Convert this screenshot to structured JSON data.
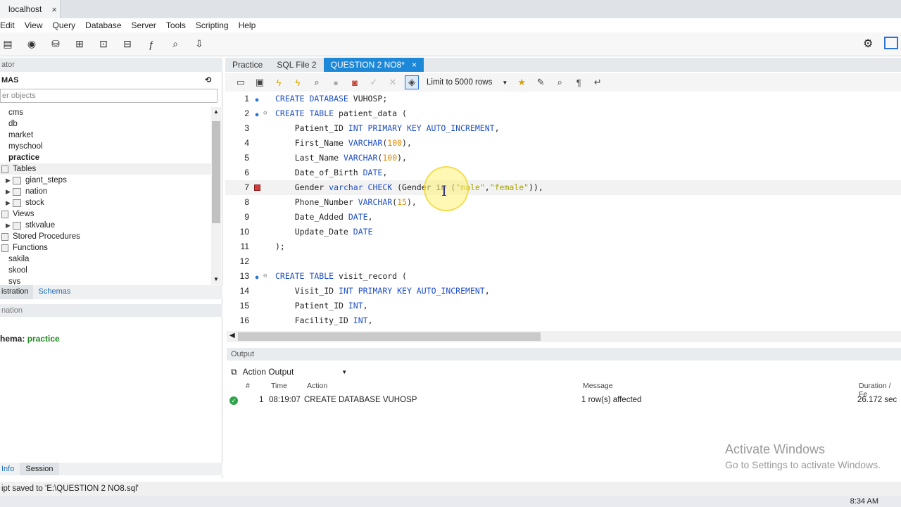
{
  "conn_tab": {
    "title": "localhost",
    "close": "×"
  },
  "menu": [
    "Edit",
    "View",
    "Query",
    "Database",
    "Server",
    "Tools",
    "Scripting",
    "Help"
  ],
  "navigator": {
    "header": "ator",
    "schemas_label": "MAS",
    "filter_placeholder": "er objects",
    "tree": [
      {
        "label": "cms",
        "indent": 0,
        "bold": false,
        "toggle": ""
      },
      {
        "label": "db",
        "indent": 0,
        "bold": false,
        "toggle": ""
      },
      {
        "label": "market",
        "indent": 0,
        "bold": false,
        "toggle": ""
      },
      {
        "label": "myschool",
        "indent": 0,
        "bold": false,
        "toggle": ""
      },
      {
        "label": "practice",
        "indent": 0,
        "bold": true,
        "toggle": ""
      },
      {
        "label": "Tables",
        "indent": 0,
        "bold": false,
        "toggle": "",
        "folder": true
      },
      {
        "label": "giant_steps",
        "indent": 1,
        "bold": false,
        "toggle": "▶",
        "table": true
      },
      {
        "label": "nation",
        "indent": 1,
        "bold": false,
        "toggle": "▶",
        "table": true
      },
      {
        "label": "stock",
        "indent": 1,
        "bold": false,
        "toggle": "▶",
        "table": true
      },
      {
        "label": "Views",
        "indent": 0,
        "bold": false,
        "toggle": "",
        "folder": true
      },
      {
        "label": "stkvalue",
        "indent": 1,
        "bold": false,
        "toggle": "▶",
        "table": true
      },
      {
        "label": "Stored Procedures",
        "indent": 0,
        "bold": false,
        "toggle": "",
        "folder": true
      },
      {
        "label": "Functions",
        "indent": 0,
        "bold": false,
        "toggle": "",
        "folder": true
      },
      {
        "label": "sakila",
        "indent": 0,
        "bold": false,
        "toggle": ""
      },
      {
        "label": "skool",
        "indent": 0,
        "bold": false,
        "toggle": ""
      },
      {
        "label": "sys",
        "indent": 0,
        "bold": false,
        "toggle": ""
      }
    ],
    "tabs": [
      "istration",
      "Schemas"
    ],
    "info_header": "nation",
    "schema_label": "hema:",
    "schema_value": "practice",
    "bottom_tabs": [
      "Info",
      "Session"
    ]
  },
  "editor": {
    "tabs": [
      {
        "label": "Practice",
        "active": false
      },
      {
        "label": "SQL File 2",
        "active": false
      },
      {
        "label": "QUESTION 2 NO8*",
        "active": true
      }
    ],
    "tab_close": "×",
    "limit_label": "Limit to 5000 rows",
    "lines": [
      {
        "n": "1",
        "marker": "dot",
        "fold": "",
        "html": "<span class=\"kw\">CREATE DATABASE</span> VUHOSP;"
      },
      {
        "n": "2",
        "marker": "dot",
        "fold": "⊖",
        "html": "<span class=\"kw\">CREATE TABLE</span> patient_data ("
      },
      {
        "n": "3",
        "marker": "",
        "fold": "",
        "html": "    Patient_ID <span class=\"kw\">INT PRIMARY KEY AUTO_INCREMENT</span>,"
      },
      {
        "n": "4",
        "marker": "",
        "fold": "",
        "html": "    First_Name <span class=\"kw\">VARCHAR</span>(<span class=\"num\">100</span>),"
      },
      {
        "n": "5",
        "marker": "",
        "fold": "",
        "html": "    Last_Name <span class=\"kw\">VARCHAR</span>(<span class=\"num\">100</span>),"
      },
      {
        "n": "6",
        "marker": "",
        "fold": "",
        "html": "    Date_of_Birth <span class=\"kw\">DATE</span>,"
      },
      {
        "n": "7",
        "marker": "err",
        "fold": "",
        "html": "    Gender <span class=\"kw\">varchar CHECK</span> (Gender in (<span class=\"str\">\"male\"</span>,<span class=\"str\">\"female\"</span>)),",
        "current": true
      },
      {
        "n": "8",
        "marker": "",
        "fold": "",
        "html": "    Phone_Number <span class=\"kw\">VARCHAR</span>(<span class=\"num\">15</span>),"
      },
      {
        "n": "9",
        "marker": "",
        "fold": "",
        "html": "    Date_Added <span class=\"kw\">DATE</span>,"
      },
      {
        "n": "10",
        "marker": "",
        "fold": "",
        "html": "    Update_Date <span class=\"kw\">DATE</span>"
      },
      {
        "n": "11",
        "marker": "",
        "fold": "",
        "html": ");"
      },
      {
        "n": "12",
        "marker": "",
        "fold": "",
        "html": ""
      },
      {
        "n": "13",
        "marker": "dot",
        "fold": "⊖",
        "html": "<span class=\"kw\">CREATE TABLE</span> visit_record ("
      },
      {
        "n": "14",
        "marker": "",
        "fold": "",
        "html": "    Visit_ID <span class=\"kw\">INT PRIMARY KEY AUTO_INCREMENT</span>,"
      },
      {
        "n": "15",
        "marker": "",
        "fold": "",
        "html": "    Patient_ID <span class=\"kw\">INT</span>,"
      },
      {
        "n": "16",
        "marker": "",
        "fold": "",
        "html": "    Facility_ID <span class=\"kw\">INT</span>,"
      }
    ]
  },
  "output": {
    "header": "Output",
    "selector": "Action Output",
    "columns": [
      "#",
      "Time",
      "Action",
      "Message",
      "Duration / Fe"
    ],
    "rows": [
      {
        "num": "1",
        "time": "08:19:07",
        "action": "CREATE DATABASE VUHOSP",
        "message": "1 row(s) affected",
        "duration": "26.172 sec"
      }
    ]
  },
  "watermark": {
    "line1": "Activate Windows",
    "line2": "Go to Settings to activate Windows."
  },
  "status": "ipt saved to 'E:\\QUESTION 2 NO8.sql'",
  "clock": "8:34 AM",
  "colors": {
    "accent": "#1e88d8",
    "keyword": "#1f4fc7",
    "number": "#d98a00",
    "string": "#a8a400",
    "ok": "#2fa34a",
    "error": "#d63a3a"
  }
}
